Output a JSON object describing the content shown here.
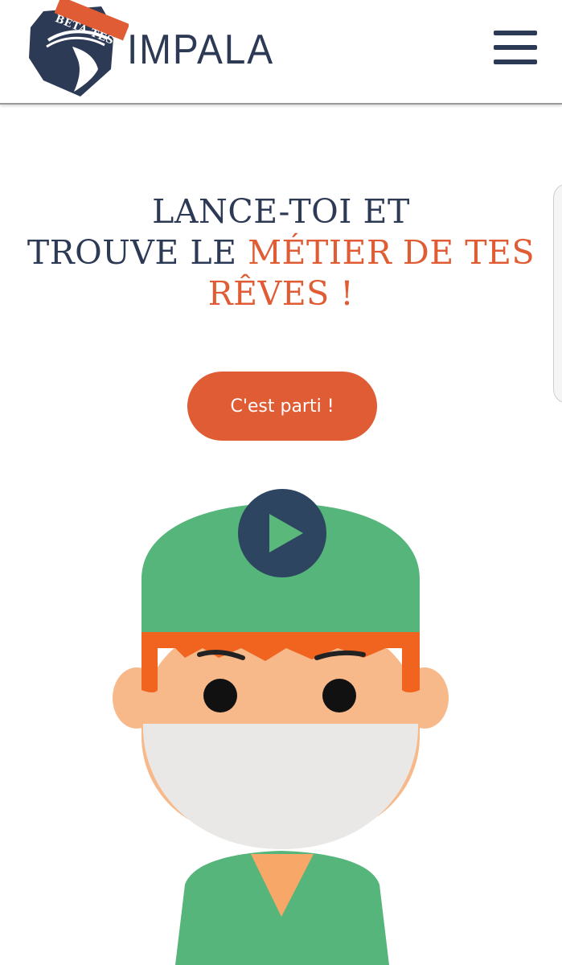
{
  "header": {
    "logo": {
      "badge_text": "BETA TEST",
      "brand_name": "IMPALA",
      "mark_icon": "impala-head-icon"
    },
    "menu_icon": "hamburger-menu-icon"
  },
  "hero": {
    "title_part1": "LANCE-TOI ET",
    "title_part2": "TROUVE LE ",
    "title_accent": "MÉTIER DE TES RÊVES !",
    "cta_label": "C'est parti !"
  },
  "media": {
    "play_icon": "play-icon",
    "illustration": "surgeon-character-illustration"
  },
  "colors": {
    "navy": "#2d3a56",
    "accent_orange": "#e05c34",
    "surgical_green": "#55b57a",
    "skin": "#f7b98a",
    "hair": "#f0641f",
    "mask": "#e9e8e6"
  }
}
